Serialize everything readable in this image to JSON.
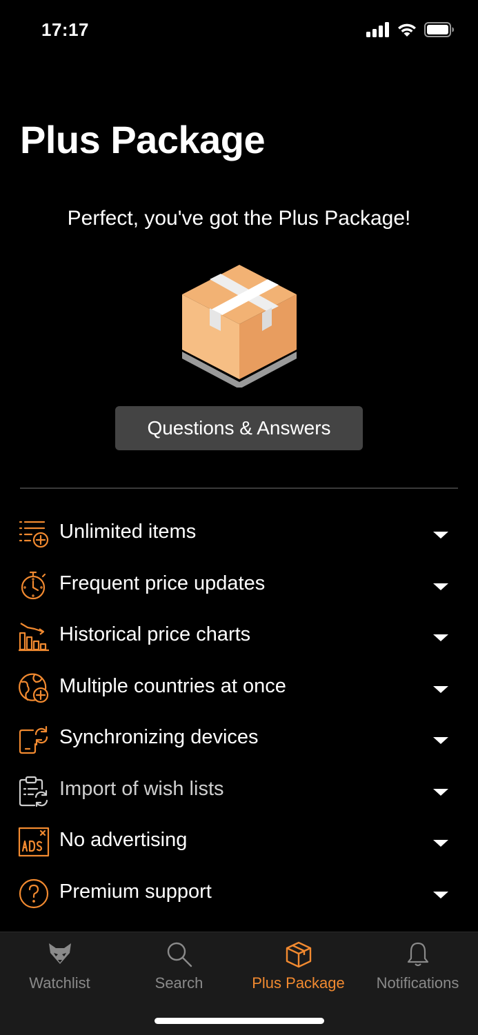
{
  "status_bar": {
    "time": "17:17"
  },
  "header": {
    "title": "Plus Package"
  },
  "subtitle": "Perfect, you've got the Plus Package!",
  "qa_button": {
    "label": "Questions & Answers"
  },
  "features": [
    {
      "label": "Unlimited items",
      "icon": "list-add-icon"
    },
    {
      "label": "Frequent price updates",
      "icon": "stopwatch-icon"
    },
    {
      "label": "Historical price charts",
      "icon": "bar-chart-trend-icon"
    },
    {
      "label": "Multiple countries at once",
      "icon": "globe-add-icon"
    },
    {
      "label": "Synchronizing devices",
      "icon": "device-sync-icon"
    },
    {
      "label": "Import of wish lists",
      "icon": "clipboard-sync-icon"
    },
    {
      "label": "No advertising",
      "icon": "ads-blocked-icon"
    },
    {
      "label": "Premium support",
      "icon": "question-circle-icon"
    }
  ],
  "tab_bar": {
    "tabs": [
      {
        "label": "Watchlist",
        "icon": "fox-icon",
        "active": false
      },
      {
        "label": "Search",
        "icon": "search-icon",
        "active": false
      },
      {
        "label": "Plus Package",
        "icon": "package-icon",
        "active": true
      },
      {
        "label": "Notifications",
        "icon": "bell-icon",
        "active": false
      }
    ]
  },
  "colors": {
    "accent": "#f28a30",
    "background": "#000000",
    "button": "#444444",
    "tab_bar": "#1b1b1b"
  }
}
